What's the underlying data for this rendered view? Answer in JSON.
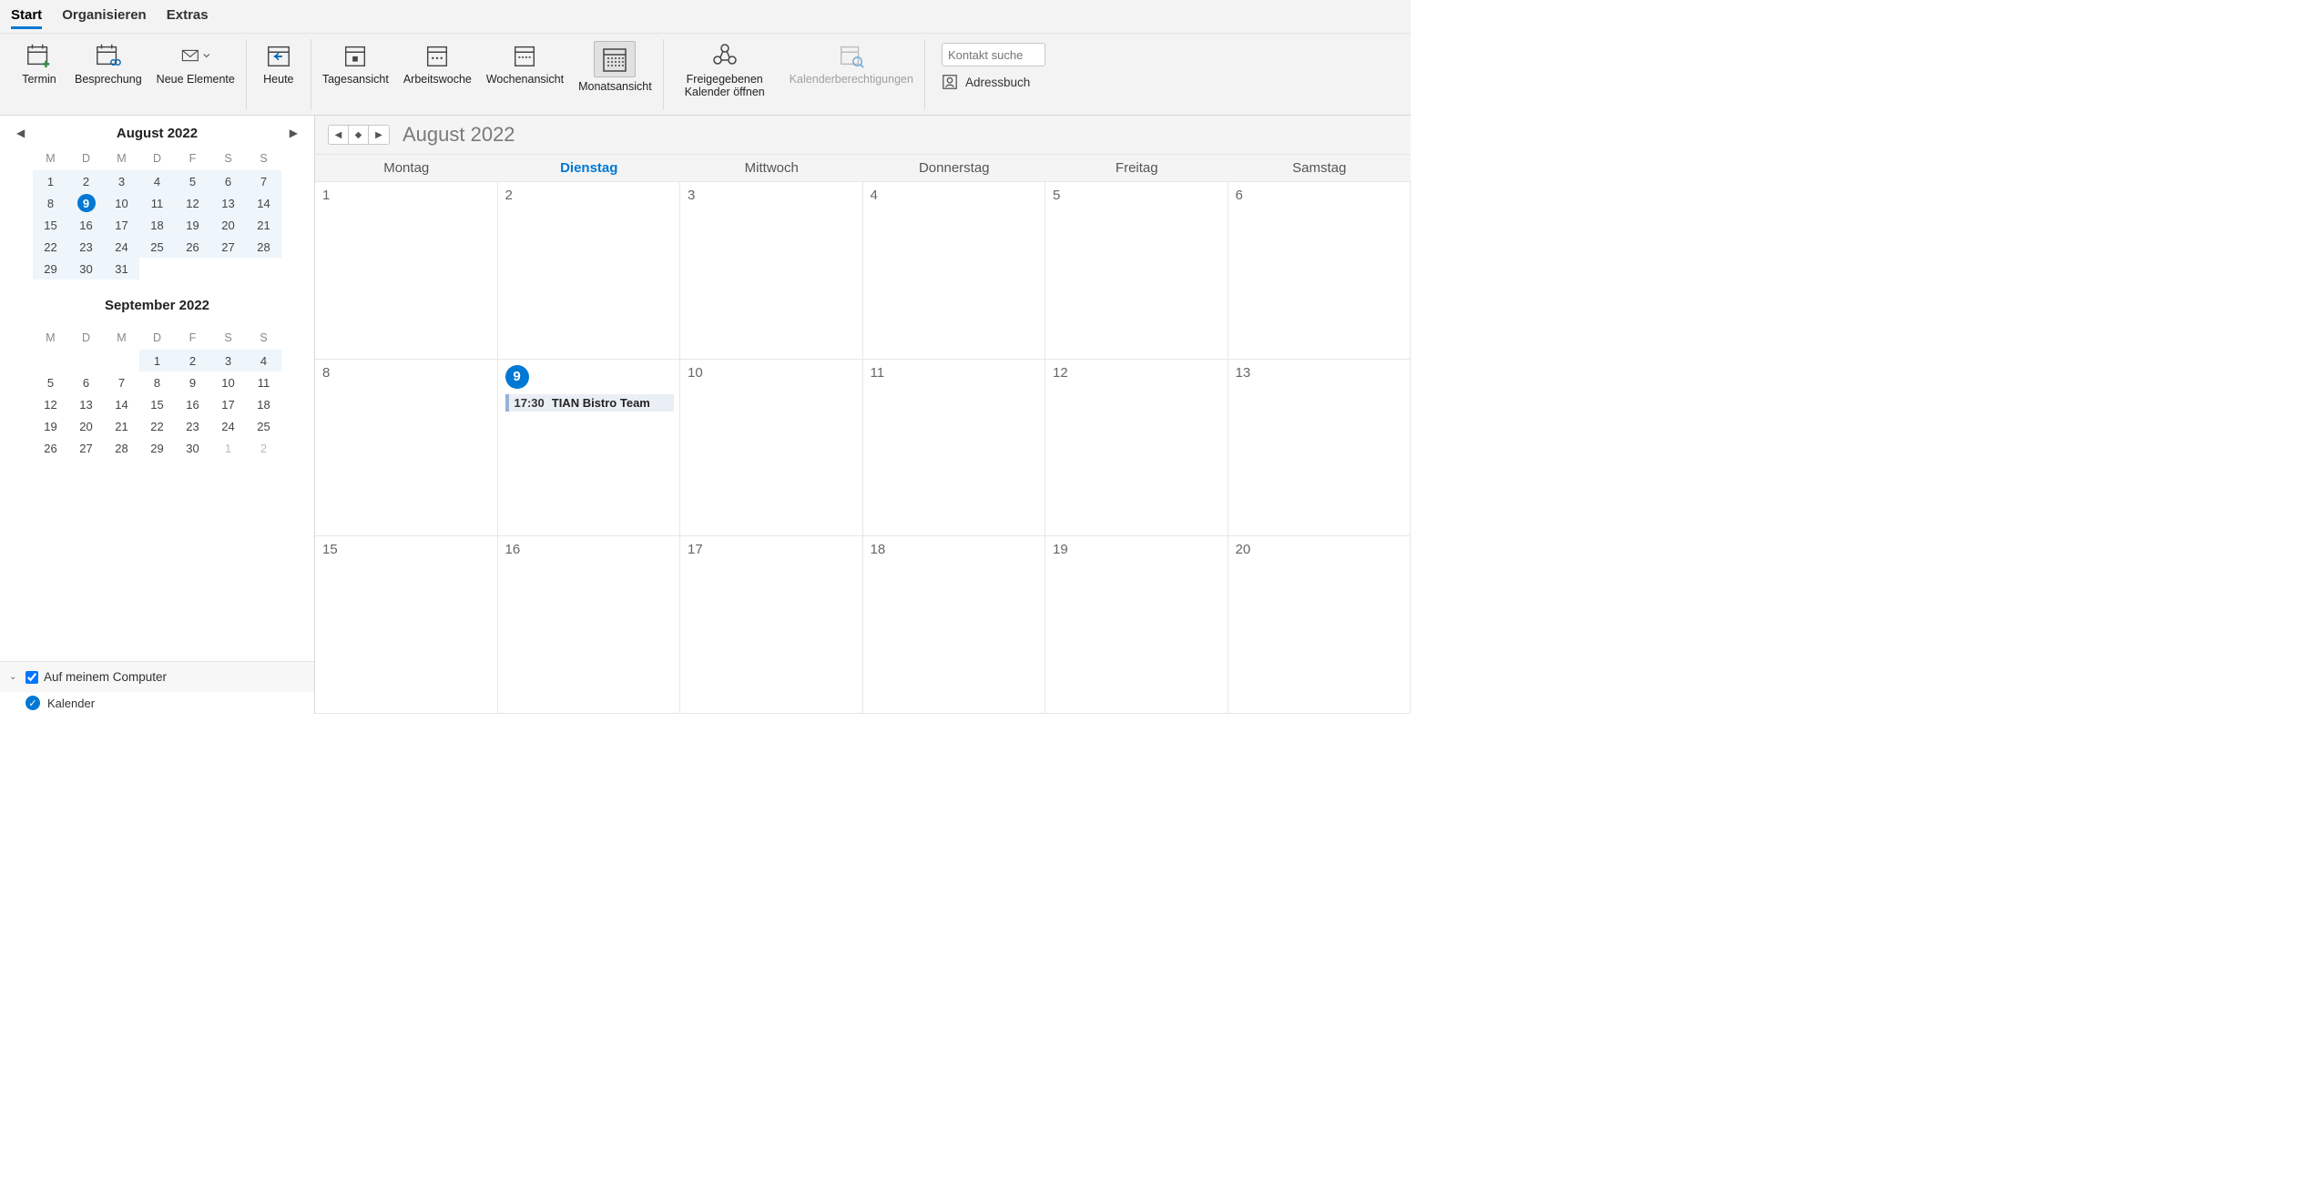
{
  "menu": {
    "tabs": [
      "Start",
      "Organisieren",
      "Extras"
    ],
    "active": 0
  },
  "ribbon": {
    "termin": "Termin",
    "besprechung": "Besprechung",
    "neue": "Neue Elemente",
    "heute": "Heute",
    "tages": "Tagesansicht",
    "arbeits": "Arbeitswoche",
    "wochen": "Wochenansicht",
    "monats": "Monatsansicht",
    "freigeg": "Freigegebenen Kalender öffnen",
    "kalberecht": "Kalenderberechtigungen",
    "search_ph": "Kontakt suche",
    "adressbuch": "Adressbuch"
  },
  "mini": {
    "month1_title": "August 2022",
    "month2_title": "September 2022",
    "dow": [
      "M",
      "D",
      "M",
      "D",
      "F",
      "S",
      "S"
    ],
    "m1": [
      {
        "n": 1,
        "hl": true
      },
      {
        "n": 2,
        "hl": true
      },
      {
        "n": 3,
        "hl": true
      },
      {
        "n": 4,
        "hl": true
      },
      {
        "n": 5,
        "hl": true
      },
      {
        "n": 6,
        "hl": true
      },
      {
        "n": 7,
        "hl": true
      },
      {
        "n": 8,
        "hl": true
      },
      {
        "n": 9,
        "hl": true,
        "today": true
      },
      {
        "n": 10,
        "hl": true
      },
      {
        "n": 11,
        "hl": true
      },
      {
        "n": 12,
        "hl": true
      },
      {
        "n": 13,
        "hl": true
      },
      {
        "n": 14,
        "hl": true
      },
      {
        "n": 15,
        "hl": true
      },
      {
        "n": 16,
        "hl": true
      },
      {
        "n": 17,
        "hl": true
      },
      {
        "n": 18,
        "hl": true
      },
      {
        "n": 19,
        "hl": true
      },
      {
        "n": 20,
        "hl": true
      },
      {
        "n": 21,
        "hl": true
      },
      {
        "n": 22,
        "hl": true
      },
      {
        "n": 23,
        "hl": true
      },
      {
        "n": 24,
        "hl": true
      },
      {
        "n": 25,
        "hl": true
      },
      {
        "n": 26,
        "hl": true
      },
      {
        "n": 27,
        "hl": true
      },
      {
        "n": 28,
        "hl": true
      },
      {
        "n": 29,
        "hl": true
      },
      {
        "n": 30,
        "hl": true
      },
      {
        "n": 31,
        "hl": true
      },
      {
        "n": "",
        "hl": false
      },
      {
        "n": "",
        "hl": false
      },
      {
        "n": "",
        "hl": false
      },
      {
        "n": "",
        "hl": false
      }
    ],
    "m2": [
      {
        "n": "",
        "hl": false
      },
      {
        "n": "",
        "hl": false
      },
      {
        "n": "",
        "hl": false
      },
      {
        "n": 1,
        "hl": true
      },
      {
        "n": 2,
        "hl": true
      },
      {
        "n": 3,
        "hl": true
      },
      {
        "n": 4,
        "hl": true
      },
      {
        "n": 5
      },
      {
        "n": 6
      },
      {
        "n": 7
      },
      {
        "n": 8
      },
      {
        "n": 9
      },
      {
        "n": 10
      },
      {
        "n": 11
      },
      {
        "n": 12
      },
      {
        "n": 13
      },
      {
        "n": 14
      },
      {
        "n": 15
      },
      {
        "n": 16
      },
      {
        "n": 17
      },
      {
        "n": 18
      },
      {
        "n": 19
      },
      {
        "n": 20
      },
      {
        "n": 21
      },
      {
        "n": 22
      },
      {
        "n": 23
      },
      {
        "n": 24
      },
      {
        "n": 25
      },
      {
        "n": 26
      },
      {
        "n": 27
      },
      {
        "n": 28
      },
      {
        "n": 29
      },
      {
        "n": 30
      },
      {
        "n": 1,
        "other": true
      },
      {
        "n": 2,
        "other": true
      }
    ]
  },
  "tree": {
    "root": "Auf meinem Computer",
    "cal": "Kalender"
  },
  "view": {
    "title": "August 2022",
    "dow": [
      "Montag",
      "Dienstag",
      "Mittwoch",
      "Donnerstag",
      "Freitag",
      "Samstag"
    ],
    "active_dow": 1,
    "days": [
      {
        "n": 1
      },
      {
        "n": 2
      },
      {
        "n": 3
      },
      {
        "n": 4
      },
      {
        "n": 5
      },
      {
        "n": 6
      },
      {
        "n": 8
      },
      {
        "n": 9,
        "today": true,
        "event": {
          "time": "17:30",
          "title": "TIAN Bistro Team"
        }
      },
      {
        "n": 10
      },
      {
        "n": 11
      },
      {
        "n": 12
      },
      {
        "n": 13
      },
      {
        "n": 15
      },
      {
        "n": 16
      },
      {
        "n": 17
      },
      {
        "n": 18
      },
      {
        "n": 19
      },
      {
        "n": 20
      }
    ]
  }
}
